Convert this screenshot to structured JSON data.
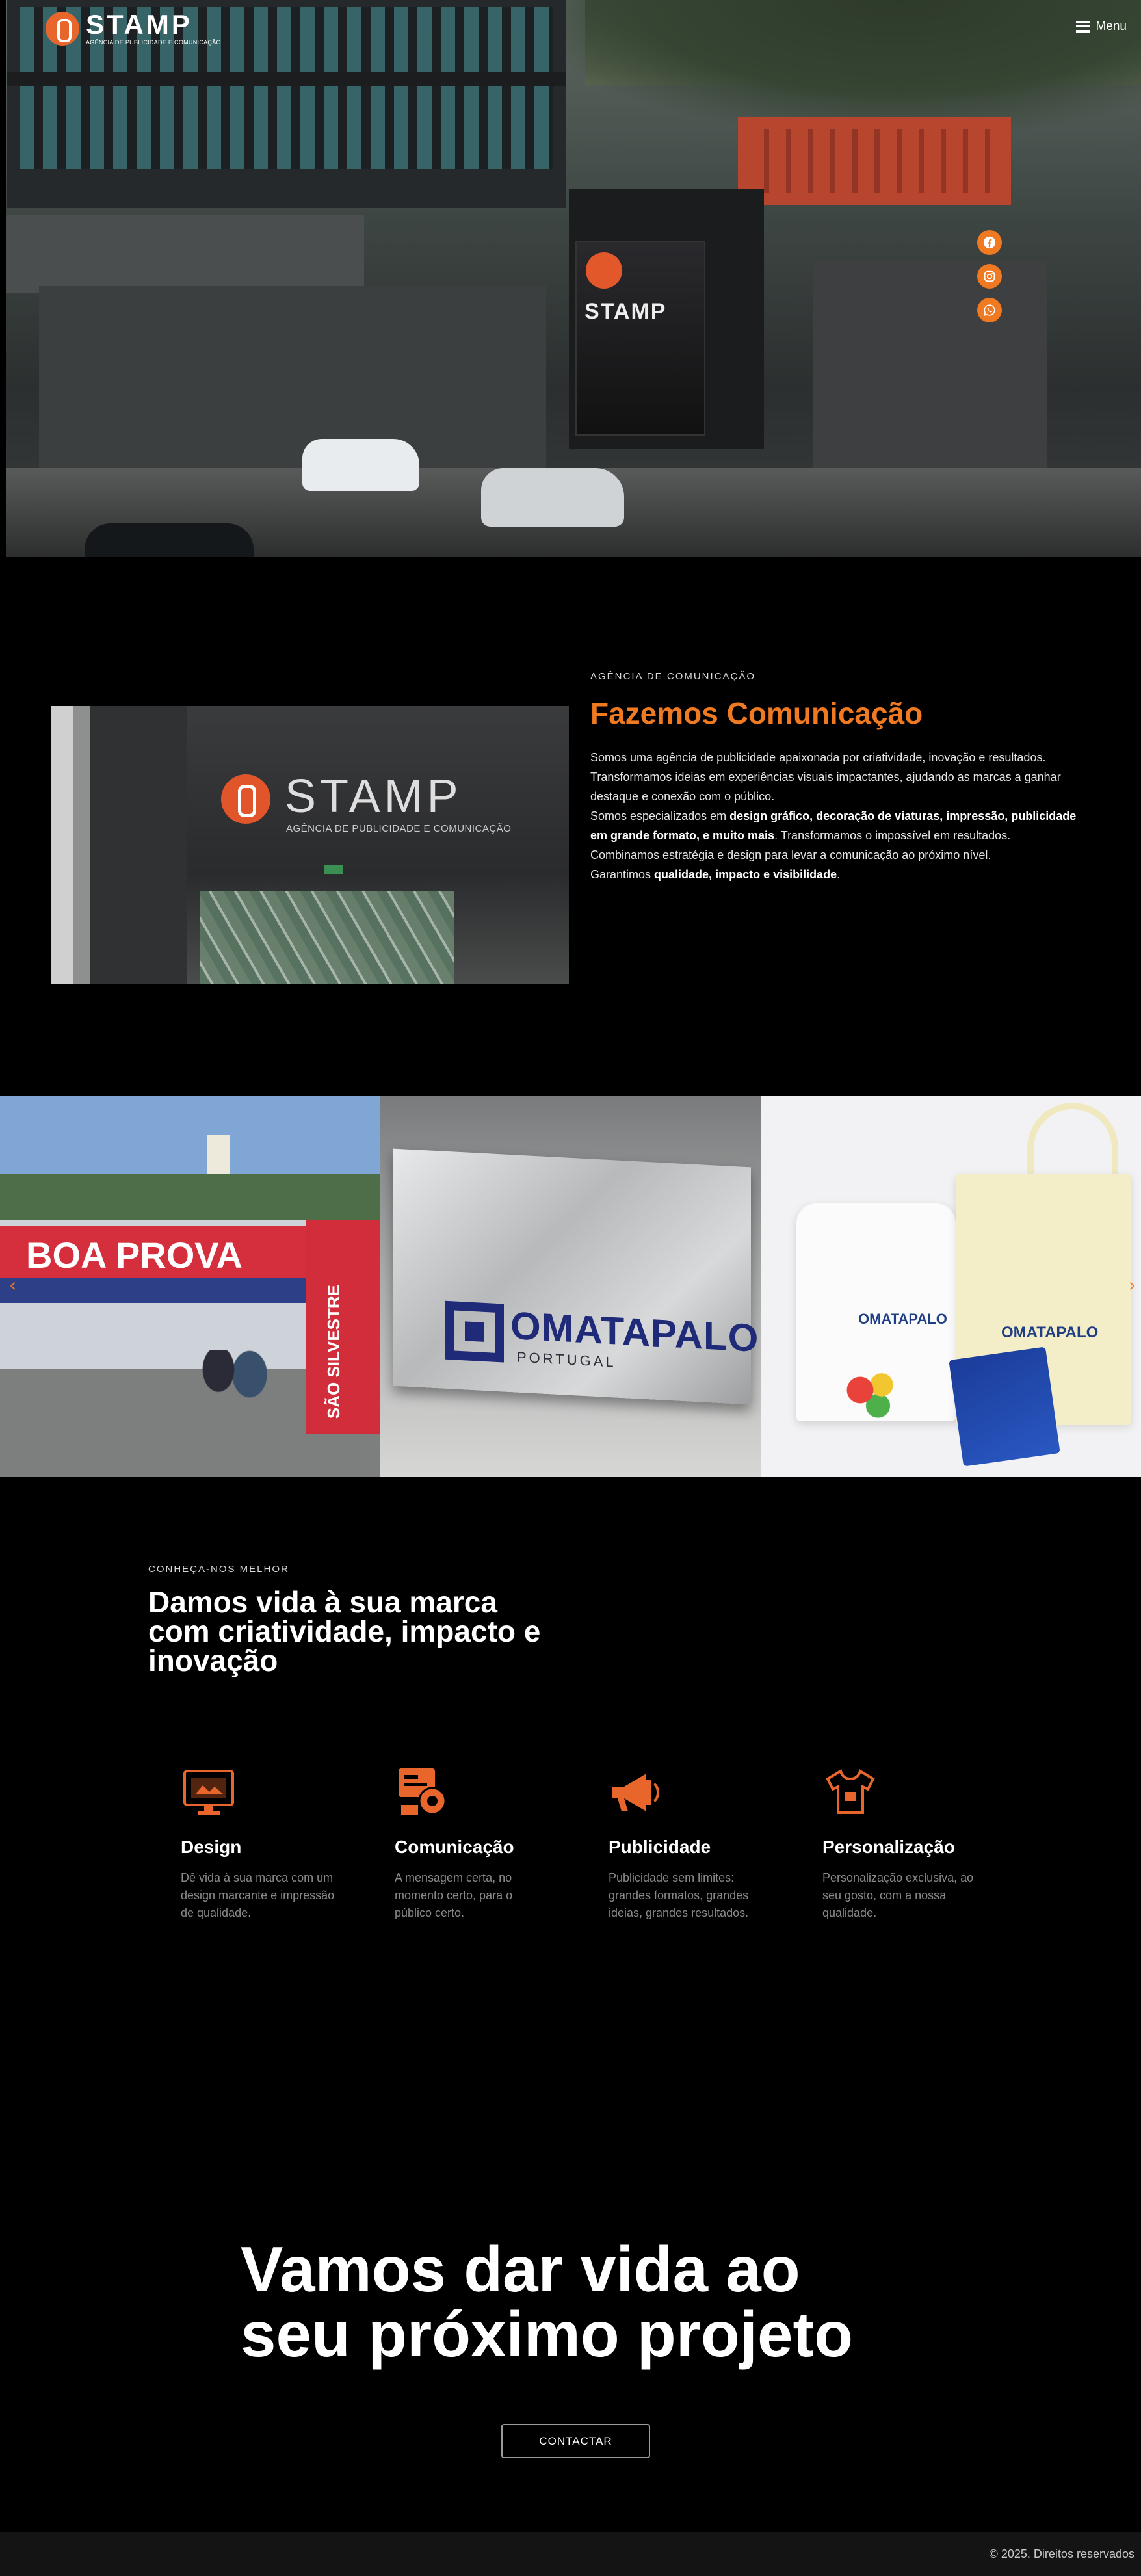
{
  "header": {
    "brand_name": "STAMP",
    "brand_tagline": "AGÊNCIA DE PUBLICIDADE E COMUNICAÇÃO",
    "menu_label": "Menu"
  },
  "social": {
    "items": [
      {
        "name": "facebook-icon"
      },
      {
        "name": "instagram-icon"
      },
      {
        "name": "whatsapp-icon"
      }
    ],
    "color": "#f07a22"
  },
  "about": {
    "eyebrow": "AGÊNCIA DE COMUNICAÇÃO",
    "title": "Fazemos Comunicação",
    "p1": "Somos uma agência de publicidade apaixonada por criatividade, inovação e resultados.",
    "p2": "Transformamos ideias em experiências visuais impactantes, ajudando as marcas a ganhar destaque e conexão com o público.",
    "p3_pre": "Somos especializados em ",
    "p3_bold": "design gráfico, decoração de viaturas, impressão, publicidade em grande formato, e muito mais",
    "p3_post": ". Transformamos o impossível em resultados.",
    "p4": "Combinamos estratégia e design para levar a comunicação ao próximo nível.",
    "p5_pre": "Garantimos ",
    "p5_bold": "qualidade, impacto e visibilidade",
    "p5_post": ".",
    "photo_sign_name": "STAMP",
    "photo_sign_sub": "AGÊNCIA DE PUBLICIDADE E COMUNICAÇÃO"
  },
  "gallery": {
    "slide1_text": "BOA PROVA",
    "slide1_post": "SÃO SILVESTRE",
    "slide2_text": "OMATAPALO",
    "slide2_sub": "PORTUGAL",
    "slide3_text": "OMATAPALO",
    "prev_arrow": "‹",
    "next_arrow": "›"
  },
  "know": {
    "eyebrow": "CONHEÇA-NOS MELHOR",
    "title": "Damos vida à sua marca com criatividade, impacto e inovação"
  },
  "services": [
    {
      "icon": "design-icon",
      "title": "Design",
      "text": "Dê vida à sua marca com um design marcante e impressão de qualidade."
    },
    {
      "icon": "communication-icon",
      "title": "Comunicação",
      "text": "A mensagem certa, no momento certo, para o público certo."
    },
    {
      "icon": "megaphone-icon",
      "title": "Publicidade",
      "text": "Publicidade sem limites: grandes formatos, grandes ideias, grandes resultados."
    },
    {
      "icon": "tshirt-icon",
      "title": "Personalização",
      "text": "Personalização exclusiva, ao seu gosto, com a nossa qualidade."
    }
  ],
  "cta": {
    "title_line1": "Vamos dar vida ao",
    "title_line2": "seu próximo projeto",
    "button": "CONTACTAR"
  },
  "footer": {
    "copyright": "© 2025. Direitos reservados"
  },
  "colors": {
    "accent": "#f07a22",
    "background": "#000000",
    "footer_bg": "#141414"
  }
}
